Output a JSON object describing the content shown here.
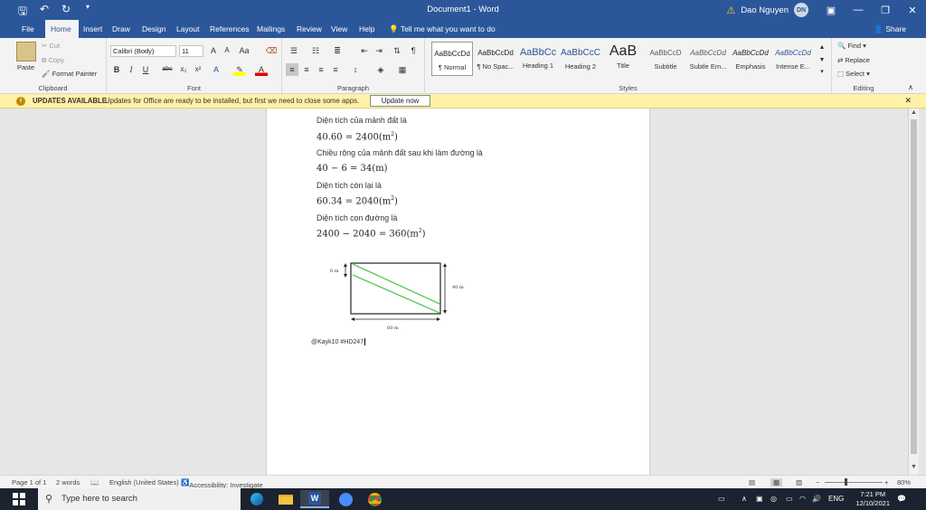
{
  "window": {
    "title": "Document1 - Word",
    "user_name": "Dao Nguyen",
    "user_initials": "DN"
  },
  "tabs": [
    "File",
    "Home",
    "Insert",
    "Draw",
    "Design",
    "Layout",
    "References",
    "Mailings",
    "Review",
    "View",
    "Help"
  ],
  "tell_me": "Tell me what you want to do",
  "share": "Share",
  "clipboard": {
    "paste": "Paste",
    "cut": "Cut",
    "copy": "Copy",
    "format_painter": "Format Painter",
    "label": "Clipboard"
  },
  "font": {
    "name": "Calibri (Body)",
    "size": "11",
    "label": "Font"
  },
  "paragraph": {
    "label": "Paragraph"
  },
  "styles": {
    "label": "Styles",
    "items": [
      {
        "sample": "AaBbCcDd",
        "name": "¶ Normal"
      },
      {
        "sample": "AaBbCcDd",
        "name": "¶ No Spac..."
      },
      {
        "sample": "AaBbCc",
        "name": "Heading 1"
      },
      {
        "sample": "AaBbCcC",
        "name": "Heading 2"
      },
      {
        "sample": "AaB",
        "name": "Title"
      },
      {
        "sample": "AaBbCcD",
        "name": "Subtitle"
      },
      {
        "sample": "AaBbCcDd",
        "name": "Subtle Em..."
      },
      {
        "sample": "AaBbCcDd",
        "name": "Emphasis"
      },
      {
        "sample": "AaBbCcDd",
        "name": "Intense E..."
      }
    ]
  },
  "editing": {
    "find": "Find",
    "replace": "Replace",
    "select": "Select",
    "label": "Editing"
  },
  "update_bar": {
    "title": "UPDATES AVAILABLE",
    "message": "Updates for Office are ready to be installed, but first we need to close some apps.",
    "button": "Update now"
  },
  "document": {
    "lines": [
      {
        "kind": "text",
        "value": "Diện tích của mảnh đất là"
      },
      {
        "kind": "math",
        "value": "40.60 = 2400(m",
        "sup": "2",
        "tail": ")"
      },
      {
        "kind": "text",
        "value": "Chiều rộng của mảnh đất sau khi làm đường là"
      },
      {
        "kind": "math",
        "value": "40 − 6 = 34(m)",
        "sup": "",
        "tail": ""
      },
      {
        "kind": "text",
        "value": "Diện tích còn lại là"
      },
      {
        "kind": "math",
        "value": "60.34 = 2040(m",
        "sup": "2",
        "tail": ")"
      },
      {
        "kind": "text",
        "value": "Diện tích con đường là"
      },
      {
        "kind": "math",
        "value": "2400 − 2040 = 360(m",
        "sup": "2",
        "tail": ")"
      }
    ],
    "figure": {
      "label_left": "6 m",
      "label_right": "40 m",
      "label_bottom": "60 m"
    },
    "signature": "@Kayk10 #HD247"
  },
  "status": {
    "page": "Page 1 of 1",
    "words": "2 words",
    "language": "English (United States)",
    "accessibility": "Accessibility: Investigate",
    "zoom": "80%"
  },
  "taskbar": {
    "search_placeholder": "Type here to search",
    "lang": "ENG",
    "time": "7:21 PM",
    "date": "12/10/2021"
  },
  "colors": {
    "brand": "#2b579a",
    "update_bar": "#fff2a8",
    "figure_lines": "#5ac85a"
  }
}
